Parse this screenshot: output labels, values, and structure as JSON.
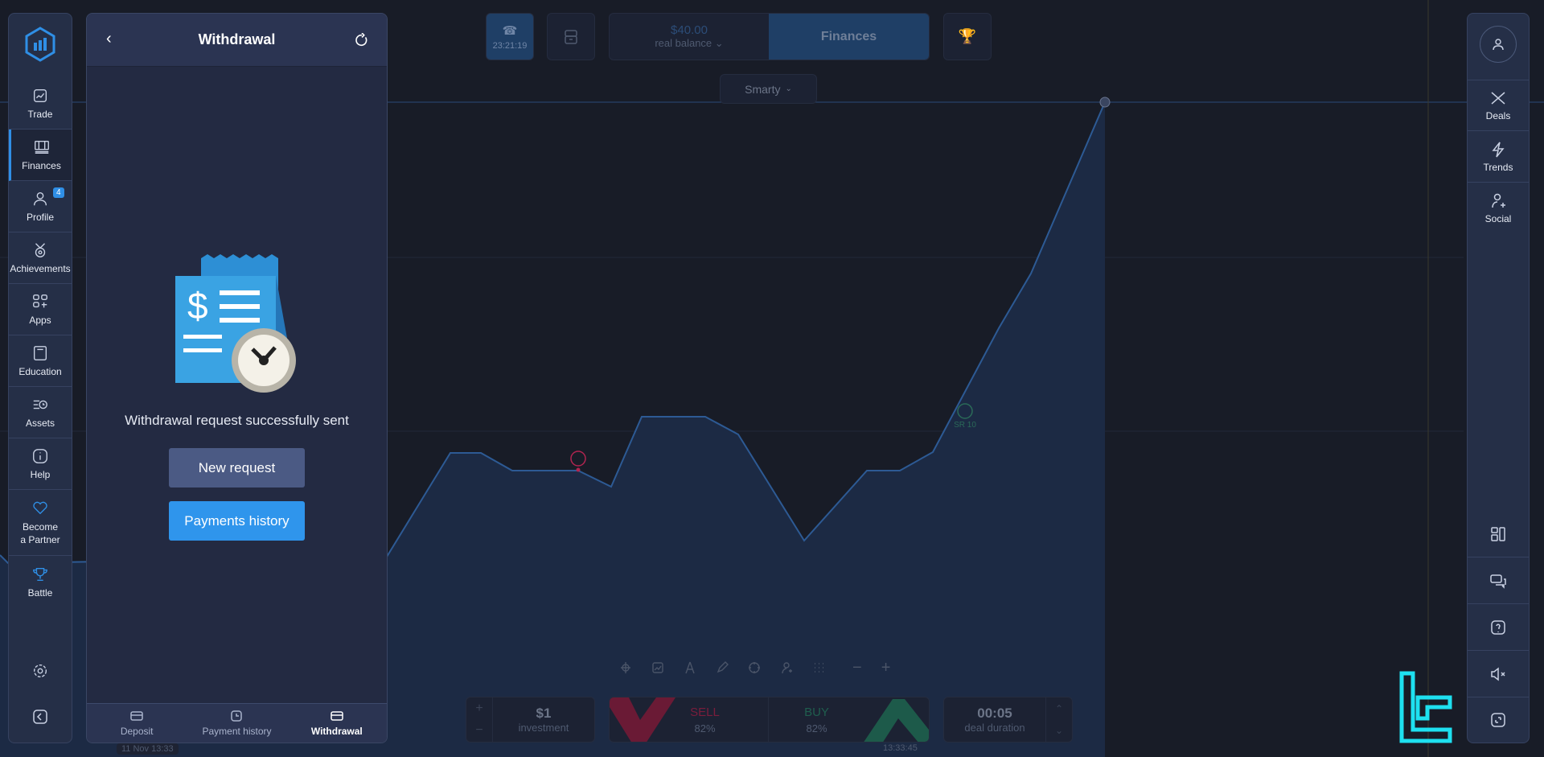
{
  "nav": {
    "items": [
      {
        "label": "Trade",
        "icon": "chart-icon"
      },
      {
        "label": "Finances",
        "icon": "finances-icon",
        "active": true
      },
      {
        "label": "Profile",
        "icon": "user-icon",
        "badge": "4"
      },
      {
        "label": "Achievements",
        "icon": "medal-icon"
      },
      {
        "label": "Apps",
        "icon": "apps-icon"
      },
      {
        "label": "Education",
        "icon": "book-icon"
      },
      {
        "label": "Assets",
        "icon": "assets-icon"
      },
      {
        "label": "Help",
        "icon": "info-icon"
      },
      {
        "label": "Become a Partner",
        "icon": "heart-icon"
      },
      {
        "label": "Battle",
        "icon": "trophy-icon"
      }
    ]
  },
  "panel": {
    "title": "Withdrawal",
    "message": "Withdrawal request successfully sent",
    "new_request": "New request",
    "payments_history": "Payments history",
    "tabs": [
      {
        "label": "Deposit"
      },
      {
        "label": "Payment history"
      },
      {
        "label": "Withdrawal",
        "active": true
      }
    ]
  },
  "topbar": {
    "timer": "23:21:19",
    "balance": "$40.00",
    "balance_label": "real balance",
    "finances": "Finances",
    "chart_type": "Smarty"
  },
  "trade": {
    "investment": "$1",
    "investment_label": "investment",
    "sell": "SELL",
    "sell_pct": "82%",
    "buy": "BUY",
    "buy_pct": "82%",
    "duration": "00:05",
    "duration_label": "deal duration",
    "time_label": "13:33:45",
    "date_label": "11 Nov 13:33"
  },
  "chart": {
    "marker_label": "SR 10"
  },
  "right": {
    "items": [
      {
        "label": "Deals"
      },
      {
        "label": "Trends"
      },
      {
        "label": "Social"
      }
    ]
  },
  "colors": {
    "accent": "#2f8fe6",
    "sell": "#c0244f",
    "buy": "#2a8a6c",
    "logo": "#1ee0f0"
  }
}
